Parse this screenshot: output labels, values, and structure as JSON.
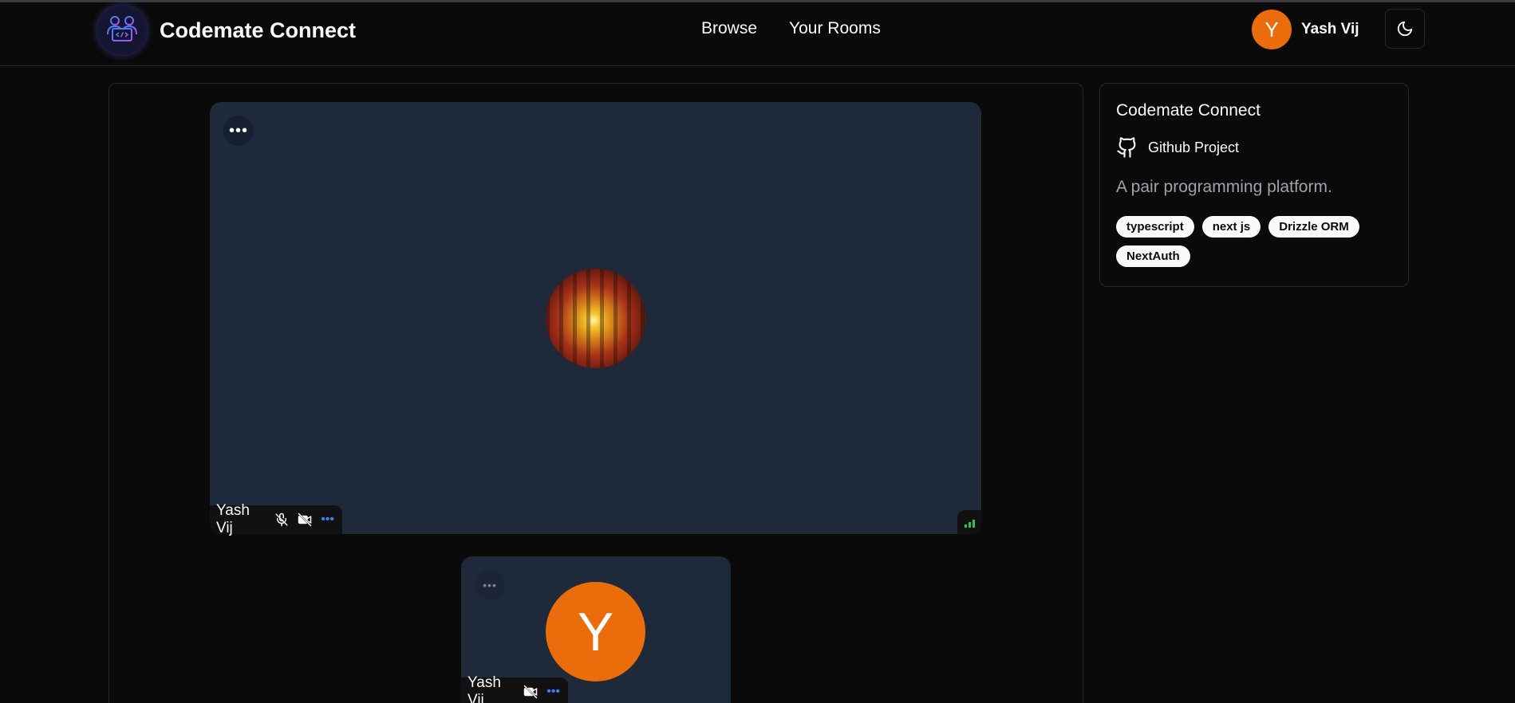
{
  "header": {
    "brand": "Codemate Connect",
    "nav": [
      {
        "label": "Browse"
      },
      {
        "label": "Your Rooms"
      }
    ],
    "user": {
      "initial": "Y",
      "name": "Yash Vij"
    },
    "theme_icon": "moon-icon"
  },
  "call": {
    "main_tile": {
      "participant_name": "Yash Vij",
      "icons": [
        "mic-off-icon",
        "video-off-icon",
        "more-icon"
      ]
    },
    "small_tile": {
      "avatar_initial": "Y",
      "participant_name": "Yash Vij",
      "icons": [
        "video-off-icon",
        "more-icon"
      ]
    }
  },
  "room": {
    "title": "Codemate Connect",
    "github_label": "Github Project",
    "github_icon": "github-icon",
    "description": "A pair programming platform.",
    "tags": [
      "typescript",
      "next js",
      "Drizzle ORM",
      "NextAuth"
    ]
  },
  "colors": {
    "background": "#0a0a0a",
    "tile": "#1e2939",
    "avatar": "#ea6c0a",
    "signal": "#22c55e",
    "accent_blue": "#3b82f6"
  }
}
